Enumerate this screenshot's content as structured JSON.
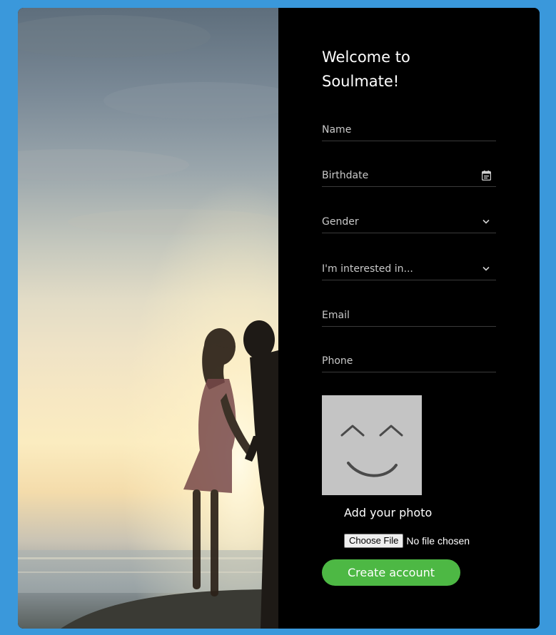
{
  "form": {
    "title_line1": "Welcome to",
    "title_line2": "Soulmate!",
    "fields": {
      "name": {
        "placeholder": "Name"
      },
      "birthdate": {
        "placeholder": "Birthdate",
        "icon": "calendar-icon"
      },
      "gender": {
        "placeholder": "Gender",
        "icon": "chevron-down-icon"
      },
      "interested": {
        "placeholder": "I'm interested in...",
        "icon": "chevron-down-icon"
      },
      "email": {
        "placeholder": "Email"
      },
      "phone": {
        "placeholder": "Phone"
      }
    },
    "photo": {
      "label": "Add your photo",
      "choose_file_label": "Choose File",
      "file_status": "No file chosen"
    },
    "submit_label": "Create account"
  },
  "colors": {
    "page_background": "#3a98db",
    "form_background": "#000000",
    "accent": "#4db844",
    "avatar_background": "#c4c4c4"
  }
}
